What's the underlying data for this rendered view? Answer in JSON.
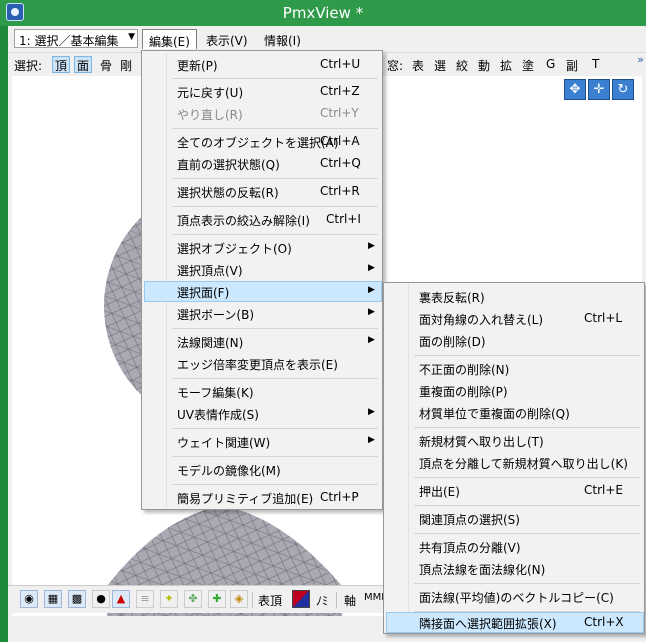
{
  "window": {
    "title": "PmxView *"
  },
  "menubar": {
    "mode_select": "1: 選択／基本編集",
    "menus": [
      "編集(E)",
      "表示(V)",
      "情報(I)"
    ]
  },
  "toolbar": {
    "select_label": "選択:",
    "items": [
      "頂",
      "面",
      "骨",
      "剛"
    ],
    "right_items": [
      "窓:",
      "表",
      "選",
      "絞",
      "動",
      "拡",
      "塗",
      "G",
      "副",
      "T"
    ],
    "overflow": "»"
  },
  "bottom_toolbar": {
    "labels": [
      "表頂",
      "ﾉﾐ",
      "軸",
      "MMD"
    ]
  },
  "edit_menu": {
    "items": [
      {
        "label": "更新(P)",
        "shortcut": "Ctrl+U"
      },
      {
        "label": "元に戻す(U)",
        "shortcut": "Ctrl+Z"
      },
      {
        "label": "やり直し(R)",
        "shortcut": "Ctrl+Y",
        "disabled": true
      },
      {
        "label": "全てのオブジェクトを選択(A)",
        "shortcut": "Ctrl+A"
      },
      {
        "label": "直前の選択状態(Q)",
        "shortcut": "Ctrl+Q"
      },
      {
        "label": "選択状態の反転(R)",
        "shortcut": "Ctrl+R"
      },
      {
        "label": "頂点表示の絞込み解除(I)",
        "shortcut": "Ctrl+I"
      },
      {
        "label": "選択オブジェクト(O)",
        "submenu": true
      },
      {
        "label": "選択頂点(V)",
        "submenu": true
      },
      {
        "label": "選択面(F)",
        "submenu": true,
        "highlighted": true
      },
      {
        "label": "選択ボーン(B)",
        "submenu": true
      },
      {
        "label": "法線関連(N)",
        "submenu": true
      },
      {
        "label": "エッジ倍率変更頂点を表示(E)"
      },
      {
        "label": "モーフ編集(K)"
      },
      {
        "label": "UV表情作成(S)",
        "submenu": true
      },
      {
        "label": "ウェイト関連(W)",
        "submenu": true
      },
      {
        "label": "モデルの鏡像化(M)"
      },
      {
        "label": "簡易プリミティブ追加(E)",
        "shortcut": "Ctrl+P"
      }
    ]
  },
  "face_submenu": {
    "items": [
      {
        "label": "裏表反転(R)"
      },
      {
        "label": "面対角線の入れ替え(L)",
        "shortcut": "Ctrl+L"
      },
      {
        "label": "面の削除(D)"
      },
      {
        "label": "不正面の削除(N)"
      },
      {
        "label": "重複面の削除(P)"
      },
      {
        "label": "材質単位で重複面の削除(Q)"
      },
      {
        "label": "新規材質へ取り出し(T)"
      },
      {
        "label": "頂点を分離して新規材質へ取り出し(K)"
      },
      {
        "label": "押出(E)",
        "shortcut": "Ctrl+E"
      },
      {
        "label": "関連頂点の選択(S)"
      },
      {
        "label": "共有頂点の分離(V)"
      },
      {
        "label": "頂点法線を面法線化(N)"
      },
      {
        "label": "面法線(平均値)のベクトルコピー(C)"
      },
      {
        "label": "隣接面へ選択範囲拡張(X)",
        "shortcut": "Ctrl+X",
        "highlighted": true
      }
    ]
  },
  "colors": {
    "title_bar": "#2e9a4a",
    "menu_bg": "#f2f2f2",
    "highlight": "#cce8ff",
    "model_gray": "#a9a9b3"
  }
}
